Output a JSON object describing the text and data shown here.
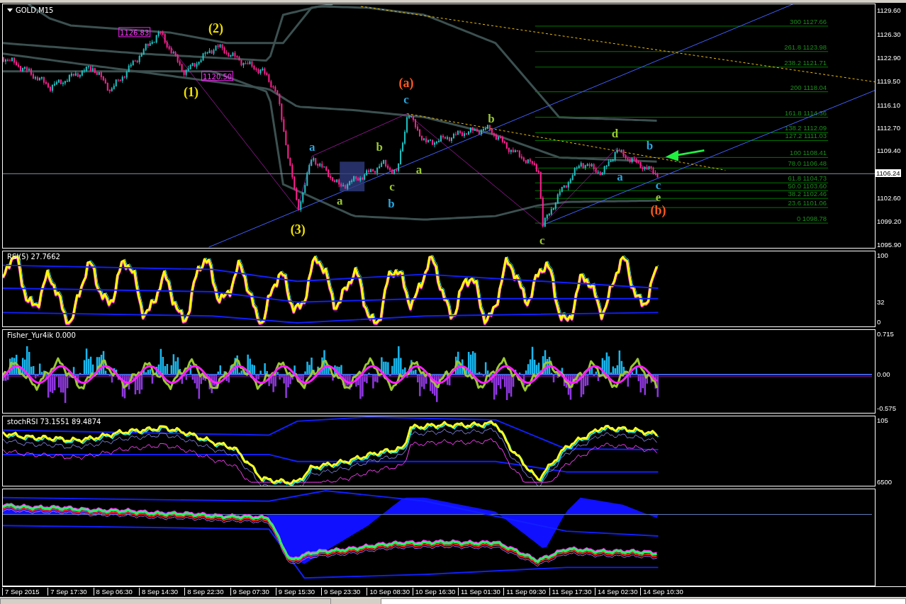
{
  "chart": {
    "title": "GOLD,M15",
    "price_axis": [
      "1129.60",
      "1126.30",
      "1122.90",
      "1119.50",
      "1116.10",
      "1112.70",
      "1109.40",
      "1102.60",
      "1099.20",
      "1095.90"
    ],
    "current_price": "1106.24",
    "fib_levels": [
      {
        "label": "300 1127.66"
      },
      {
        "label": "261.8 1123.98"
      },
      {
        "label": "238.2 1121.71"
      },
      {
        "label": "200 1118.04"
      },
      {
        "label": "161.8 1114.36"
      },
      {
        "label": "138.2 1112.09"
      },
      {
        "label": "127.2 1111.03"
      },
      {
        "label": "100 1108.41"
      },
      {
        "label": "78.0 1106.48"
      },
      {
        "label": "61.8 1104.73"
      },
      {
        "label": "50.0 1103.60"
      },
      {
        "label": "38.2 1102.46"
      },
      {
        "label": "23.6 1101.06"
      },
      {
        "label": "0 1098.78"
      }
    ],
    "price_tags": [
      "1126.83",
      "1120.50"
    ],
    "wave_labels": [
      {
        "text": "(2)",
        "color": "#f0e000"
      },
      {
        "text": "(1)",
        "color": "#f0e000"
      },
      {
        "text": "(a)",
        "color": "#ff5a1e"
      },
      {
        "text": "c",
        "color": "#28a8e0"
      },
      {
        "text": "b",
        "color": "#9ac832"
      },
      {
        "text": "a",
        "color": "#28a8e0"
      },
      {
        "text": "b",
        "color": "#9ac832"
      },
      {
        "text": "a",
        "color": "#9ac832"
      },
      {
        "text": "c",
        "color": "#9ac832"
      },
      {
        "text": "b",
        "color": "#28a8e0"
      },
      {
        "text": "a",
        "color": "#9ac832"
      },
      {
        "text": "(3)",
        "color": "#f0e000"
      },
      {
        "text": "d",
        "color": "#9ac832"
      },
      {
        "text": "b",
        "color": "#28a8e0"
      },
      {
        "text": "a",
        "color": "#28a8e0"
      },
      {
        "text": "c",
        "color": "#28a8e0"
      },
      {
        "text": "e",
        "color": "#9ac832"
      },
      {
        "text": "(b)",
        "color": "#ff5a1e"
      },
      {
        "text": "c",
        "color": "#9ac832"
      }
    ]
  },
  "panels": [
    {
      "kind": "rsi",
      "title": "RSI(5) 27.7662",
      "axis": [
        "100",
        "32",
        "0"
      ]
    },
    {
      "kind": "fisher",
      "title": "Fisher_Yur4ik 0.000",
      "axis": [
        "0.715",
        "0.00",
        "-0.575"
      ]
    },
    {
      "kind": "stoch",
      "title": "stochRSI 73.1551 89.4874",
      "axis": [
        "105",
        "6500"
      ]
    },
    {
      "kind": "bands"
    }
  ],
  "time_axis": [
    "7 Sep 2015",
    "7 Sep 17:30",
    "8 Sep 06:30",
    "8 Sep 14:30",
    "8 Sep 22:30",
    "9 Sep 07:30",
    "9 Sep 15:30",
    "9 Sep 23:30",
    "10 Sep 08:30",
    "10 Sep 16:30",
    "11 Sep 01:30",
    "11 Sep 09:30",
    "11 Sep 17:30",
    "14 Sep 02:30",
    "14 Sep 10:30"
  ]
}
